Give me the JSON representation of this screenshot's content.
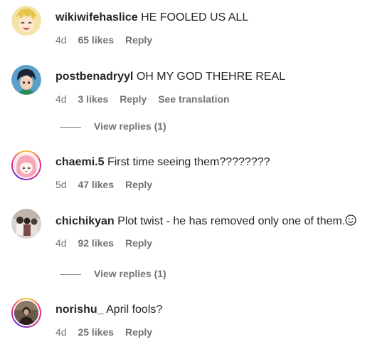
{
  "comments": [
    {
      "username": "wikiwifehaslice",
      "text": "HE FOOLED US ALL",
      "age": "4d",
      "likes": "65 likes",
      "reply": "Reply"
    },
    {
      "username": "postbenadryyl",
      "text": "OH MY GOD THEHRE REAL",
      "age": "4d",
      "likes": "3 likes",
      "reply": "Reply",
      "translate": "See translation",
      "view_replies": "View replies (1)"
    },
    {
      "username": "chaemi.5",
      "text": "First time seeing them????????",
      "age": "5d",
      "likes": "47 likes",
      "reply": "Reply"
    },
    {
      "username": "chichikyan",
      "text": "Plot twist - he has removed only one of them.",
      "emoji_icon": "smiling-face-icon",
      "age": "4d",
      "likes": "92 likes",
      "reply": "Reply",
      "view_replies": "View replies (1)"
    },
    {
      "username": "norishu_",
      "text": "April fools?",
      "age": "4d",
      "likes": "25 likes",
      "reply": "Reply"
    }
  ],
  "colors": {
    "primary_text": "#262626",
    "secondary_text": "#737373",
    "story_ring": "#ee2a7b"
  }
}
